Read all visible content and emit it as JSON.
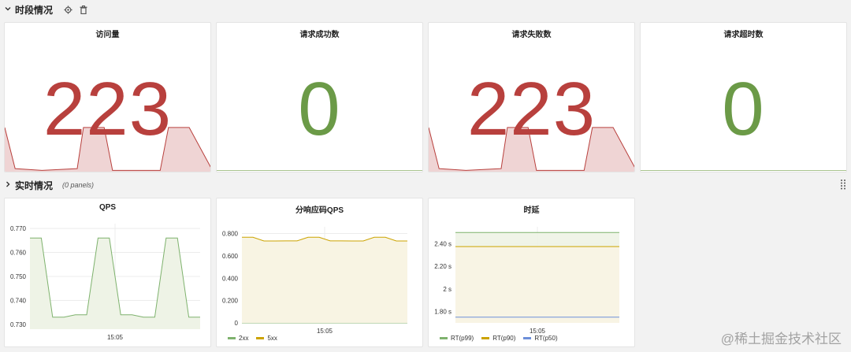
{
  "colors": {
    "red": "#b8403d",
    "green": "#6b9a47",
    "spark_red_fill": "#efd4d4",
    "line_green": "#7eb26d",
    "line_yellow": "#cca300",
    "line_blue": "#6d8fd9",
    "fill_green": "#eef3e6",
    "fill_yellow": "#f8f4e3"
  },
  "row1": {
    "title": "时段情况",
    "settings_icon": "gear-icon",
    "delete_icon": "trash-icon"
  },
  "row2": {
    "title": "实时情况",
    "meta": "(0 panels)"
  },
  "stats": [
    {
      "title": "访问量",
      "value": "223",
      "color": "red",
      "spark": [
        0.25,
        0.02,
        0.01,
        0.02,
        0.25,
        0.25,
        0.01,
        0.01,
        0.25,
        0.25
      ]
    },
    {
      "title": "请求成功数",
      "value": "0",
      "color": "green",
      "spark": []
    },
    {
      "title": "请求失败数",
      "value": "223",
      "color": "red",
      "spark": [
        0.25,
        0.02,
        0.01,
        0.02,
        0.25,
        0.25,
        0.01,
        0.01,
        0.25,
        0.25
      ]
    },
    {
      "title": "请求超时数",
      "value": "0",
      "color": "green",
      "spark": []
    }
  ],
  "charts": {
    "qps": {
      "title": "QPS",
      "chart_data": {
        "type": "area",
        "x": [
          "",
          "",
          "",
          "",
          "",
          "",
          "",
          "",
          "",
          "",
          "",
          "",
          "",
          "",
          "",
          ""
        ],
        "series": [
          {
            "values": [
              0.766,
              0.766,
              0.733,
              0.733,
              0.734,
              0.734,
              0.766,
              0.766,
              0.734,
              0.734,
              0.733,
              0.733,
              0.766,
              0.766,
              0.733,
              0.733
            ]
          }
        ],
        "yticks": [
          "0.770",
          "0.760",
          "0.750",
          "0.740",
          "0.730"
        ],
        "ytick_values": [
          0.77,
          0.76,
          0.75,
          0.74,
          0.73
        ],
        "ylim": [
          0.728,
          0.772
        ],
        "xtick": "15:05"
      }
    },
    "codes": {
      "title": "分响应码QPS",
      "chart_data": {
        "type": "area",
        "series": [
          {
            "name": "2xx",
            "color": "line_green",
            "values": [
              0,
              0,
              0,
              0,
              0,
              0,
              0,
              0,
              0,
              0,
              0,
              0,
              0,
              0,
              0,
              0
            ]
          },
          {
            "name": "5xx",
            "color": "line_yellow",
            "values": [
              0.766,
              0.766,
              0.733,
              0.733,
              0.734,
              0.734,
              0.766,
              0.766,
              0.734,
              0.734,
              0.733,
              0.733,
              0.766,
              0.766,
              0.733,
              0.733
            ]
          }
        ],
        "yticks": [
          "0.800",
          "0.600",
          "0.400",
          "0.200",
          "0"
        ],
        "ytick_values": [
          0.8,
          0.6,
          0.4,
          0.2,
          0
        ],
        "ylim": [
          0,
          0.86
        ],
        "xtick": "15:05"
      }
    },
    "latency": {
      "title": "时延",
      "chart_data": {
        "type": "area",
        "series": [
          {
            "name": "RT(p99)",
            "color": "line_green",
            "values": [
              2.5,
              2.5
            ]
          },
          {
            "name": "RT(p90)",
            "color": "line_yellow",
            "values": [
              2.375,
              2.375
            ]
          },
          {
            "name": "RT(p50)",
            "color": "line_blue",
            "values": [
              1.75,
              1.75
            ]
          }
        ],
        "yticks": [
          "2.40 s",
          "2.20 s",
          "2 s",
          "1.80 s"
        ],
        "ytick_values": [
          2.4,
          2.2,
          2.0,
          1.8
        ],
        "ylim": [
          1.7,
          2.55
        ],
        "xtick": "15:05"
      }
    }
  },
  "watermark": "@稀土掘金技术社区"
}
